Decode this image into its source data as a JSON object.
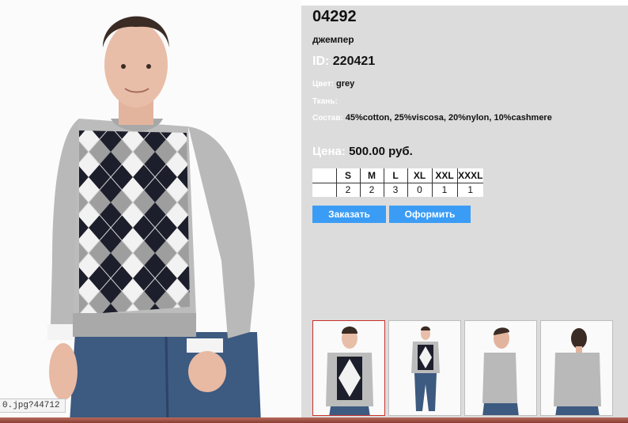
{
  "product": {
    "sku": "04292",
    "kind": "джемпер",
    "id_label": "ID:",
    "id_value": "220421",
    "color_label": "Цвет:",
    "color_value": "grey",
    "fabric_label": "Ткань:",
    "fabric_value": "",
    "composition_label": "Состав:",
    "composition_value": "45%cotton, 25%viscosa, 20%nylon, 10%cashmere",
    "price_label": "Цена:",
    "price_value": "500.00 руб."
  },
  "sizes": {
    "headers": [
      "",
      "S",
      "M",
      "L",
      "XL",
      "XXL",
      "XXXL"
    ],
    "counts": [
      "",
      "2",
      "2",
      "3",
      "0",
      "1",
      "1"
    ]
  },
  "buttons": {
    "order": "Заказать",
    "checkout": "Оформить"
  },
  "status_url": "0.jpg?44712",
  "colors": {
    "panel": "#dcdcdc",
    "button": "#3b9cf5",
    "active_thumb_border": "#c9302c",
    "bottom_strip": "#8a3e33"
  },
  "thumbnails": [
    {
      "name": "front-closeup",
      "active": true
    },
    {
      "name": "front-full",
      "active": false
    },
    {
      "name": "side",
      "active": false
    },
    {
      "name": "back",
      "active": false
    }
  ]
}
